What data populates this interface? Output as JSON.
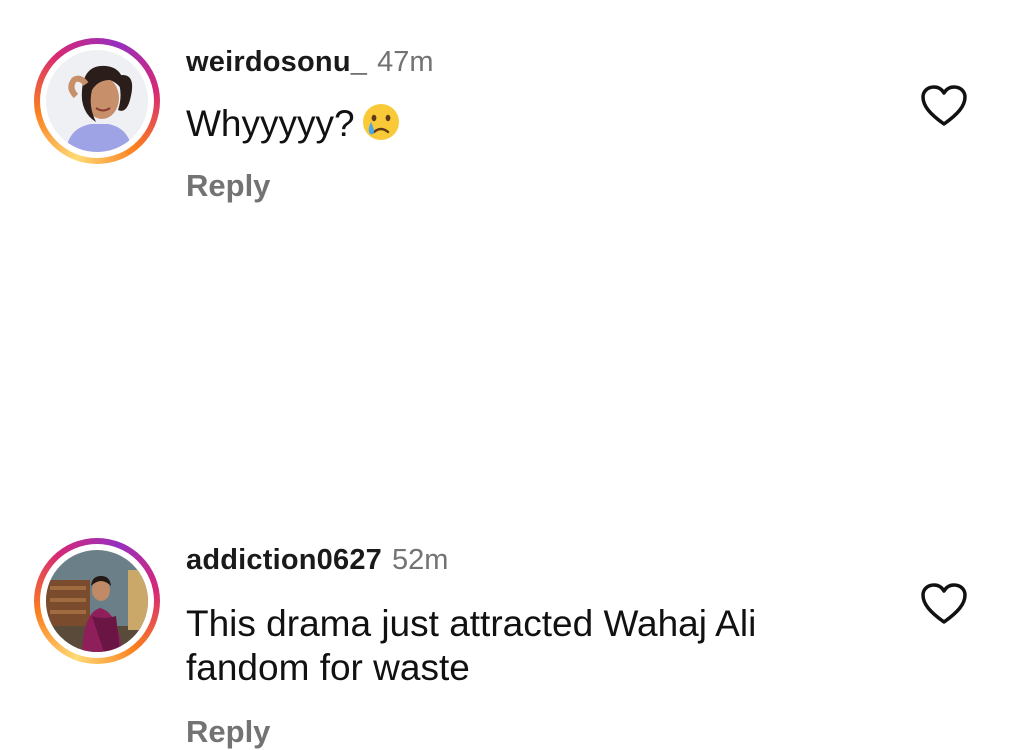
{
  "comments": [
    {
      "username": "weirdosonu_",
      "time": "47m",
      "text": "Whyyyyy?",
      "emoji": "crying-face",
      "reply_label": "Reply",
      "like_icon": "heart-outline-icon"
    },
    {
      "username": "addiction0627",
      "time": "52m",
      "text": "This drama just attracted Wahaj Ali fandom for waste",
      "reply_label": "Reply",
      "like_icon": "heart-outline-icon"
    }
  ],
  "colors": {
    "text": "#111111",
    "muted": "#737373",
    "story_ring_start": "#feda75",
    "story_ring_mid": "#d62976",
    "story_ring_end": "#962fbf"
  }
}
